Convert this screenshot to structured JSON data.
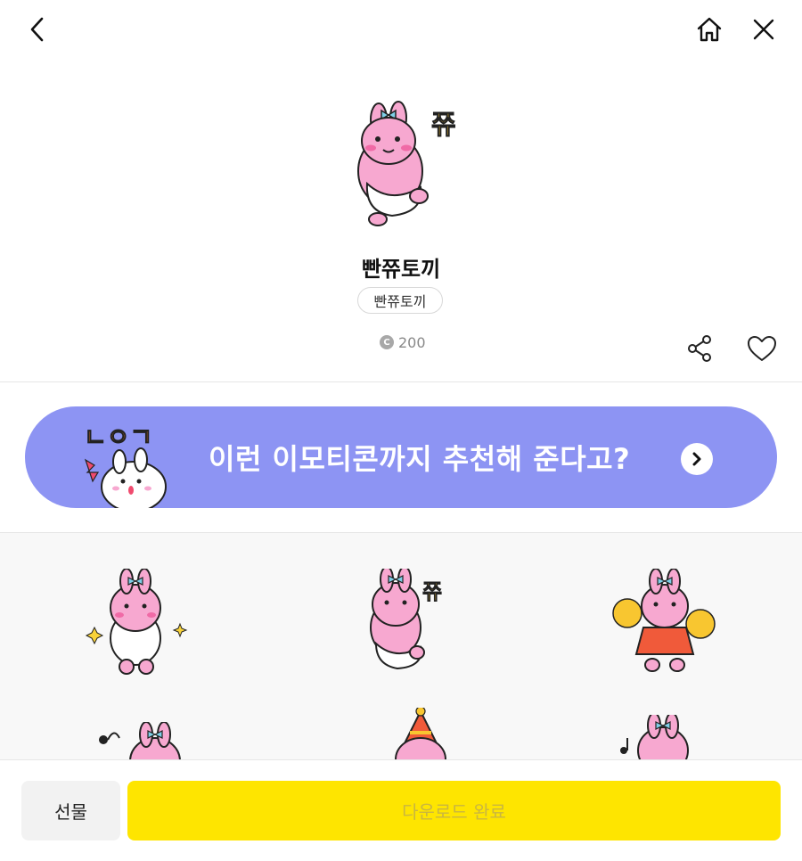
{
  "header": {
    "back_icon": "chevron-left-icon",
    "home_icon": "home-icon",
    "close_icon": "close-icon"
  },
  "product": {
    "title": "빤쮸토끼",
    "author": "빤쮸토끼",
    "coin_symbol": "C",
    "price": "200",
    "share_icon": "share-icon",
    "like_icon": "heart-icon"
  },
  "banner": {
    "text": "이런 이모티콘까지 추천해 준다고?",
    "art_letters": "ㄴㅇㄱ",
    "arrow_icon": "chevron-right-icon",
    "background_color": "#8d94f3"
  },
  "emoticons": [
    {
      "name": "sparkle-bunny"
    },
    {
      "name": "jjyu-bunny"
    },
    {
      "name": "cheer-bunny"
    },
    {
      "name": "music-bunny"
    },
    {
      "name": "party-hat-bunny"
    },
    {
      "name": "note-bunny"
    }
  ],
  "hero_text": "쮸",
  "footer": {
    "gift_label": "선물",
    "download_label": "다운로드 완료",
    "download_color": "#fee500"
  }
}
